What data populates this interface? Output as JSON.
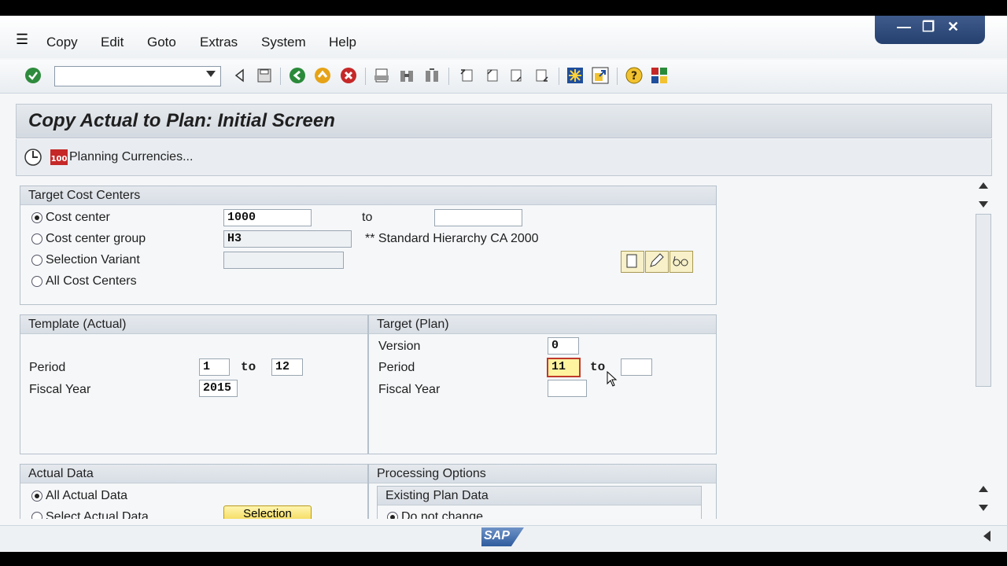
{
  "menu": [
    "Copy",
    "Edit",
    "Goto",
    "Extras",
    "System",
    "Help"
  ],
  "window_controls": {
    "minimize": "—",
    "restore": "❐",
    "close": "✕"
  },
  "title": "Copy Actual to Plan: Initial Screen",
  "app_toolbar": {
    "planning_currencies": "Planning Currencies..."
  },
  "target_cost_centers": {
    "header": "Target Cost Centers",
    "rows": [
      {
        "label": "Cost center",
        "value": "1000"
      },
      {
        "label": "Cost center group",
        "value": "H3"
      },
      {
        "label": "Selection Variant",
        "value": ""
      },
      {
        "label": "All Cost Centers"
      }
    ],
    "to_label": "to",
    "to_value": "",
    "group_desc": "** Standard Hierarchy  CA 2000"
  },
  "template_actual": {
    "header": "Template (Actual)",
    "period_label": "Period",
    "period_from": "1",
    "to_label": "to",
    "period_to": "12",
    "fiscal_year_label": "Fiscal Year",
    "fiscal_year": "2015"
  },
  "target_plan": {
    "header": "Target (Plan)",
    "version_label": "Version",
    "version": "0",
    "period_label": "Period",
    "period_from": "11",
    "to_label": "to",
    "period_to": "",
    "fiscal_year_label": "Fiscal Year",
    "fiscal_year": ""
  },
  "actual_data": {
    "header": "Actual Data",
    "all_label": "All Actual Data",
    "select_label": "Select Actual Data",
    "selection_button": "Selection"
  },
  "processing_options": {
    "header": "Processing Options",
    "existing_header": "Existing Plan Data",
    "do_not_change": "Do not change"
  },
  "status": {
    "logo": "SAP"
  },
  "colors": {
    "accent": "#25406e",
    "highlight": "#fff3a0",
    "error_border": "#c0392b"
  }
}
